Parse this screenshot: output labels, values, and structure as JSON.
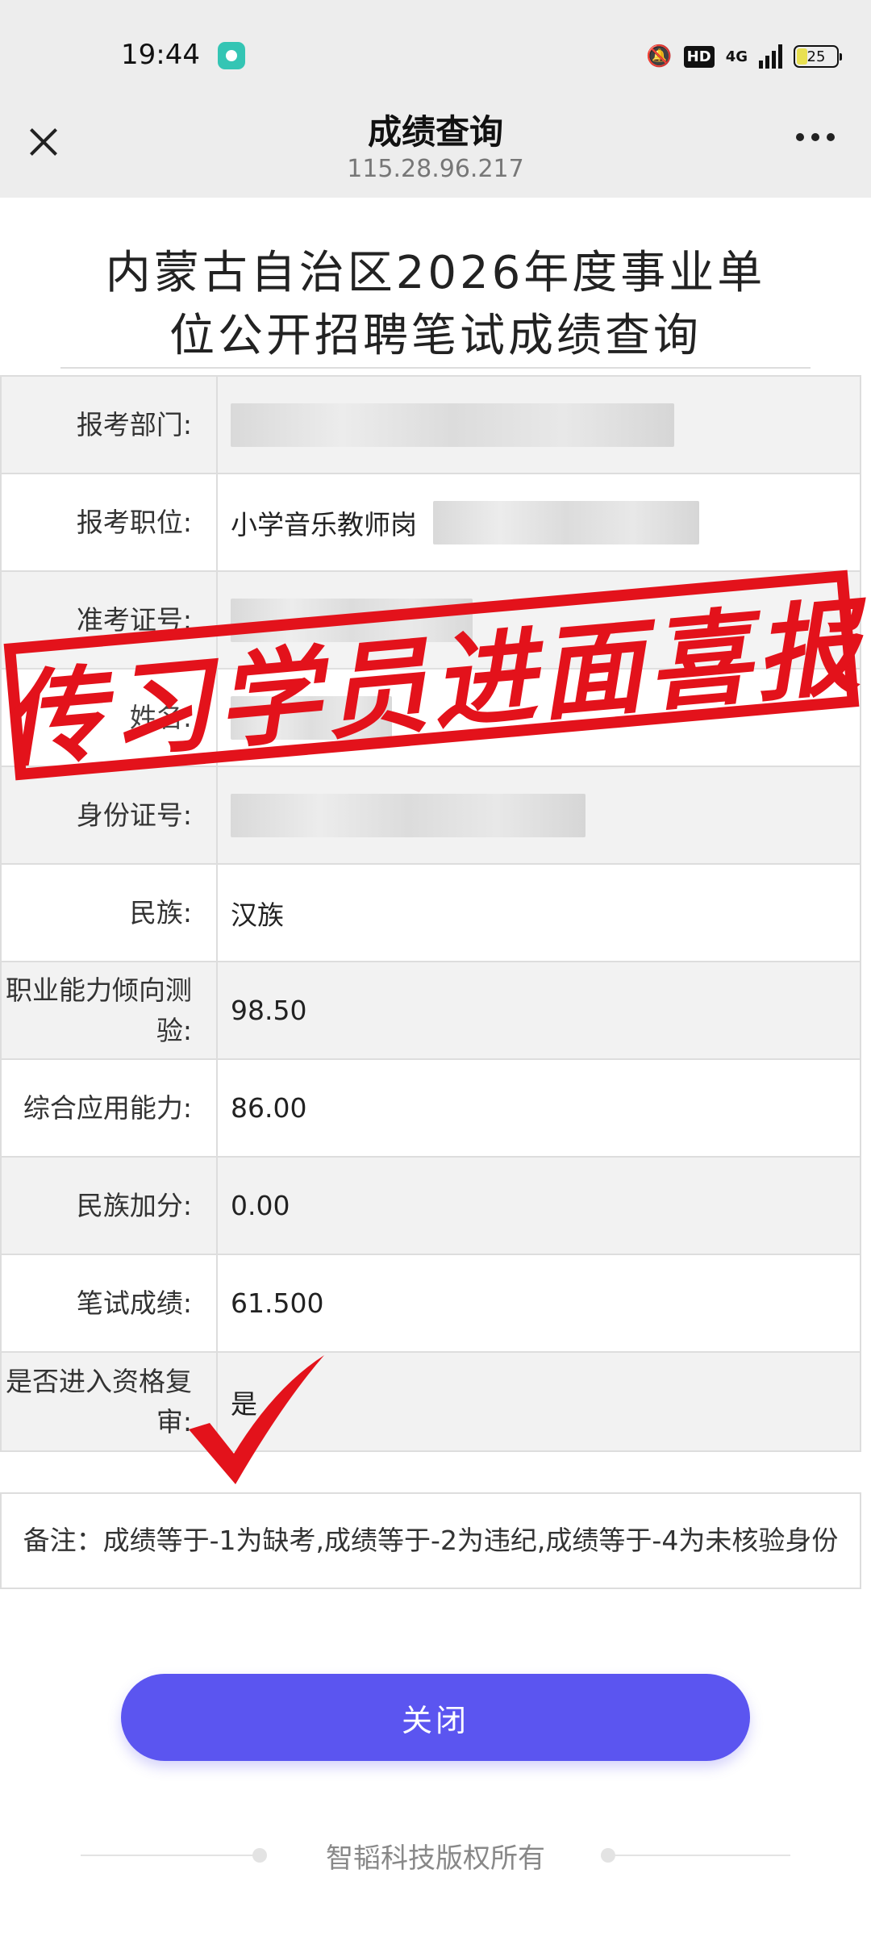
{
  "status_bar": {
    "time": "19:44",
    "hd": "HD",
    "network": "4G",
    "battery": "25"
  },
  "nav": {
    "title": "成绩查询",
    "url": "115.28.96.217"
  },
  "page": {
    "title_line1": "内蒙古自治区2026年度事业单",
    "title_line2": "位公开招聘笔试成绩查询"
  },
  "table": {
    "rows": [
      {
        "label": "报考部门:",
        "value": ""
      },
      {
        "label": "报考职位:",
        "value": "小学音乐教师岗"
      },
      {
        "label": "准考证号:",
        "value": ""
      },
      {
        "label": "姓名:",
        "value": ""
      },
      {
        "label": "身份证号:",
        "value": ""
      },
      {
        "label": "民族:",
        "value": "汉族"
      },
      {
        "label": "职业能力倾向测验:",
        "value": "98.50"
      },
      {
        "label": "综合应用能力:",
        "value": "86.00"
      },
      {
        "label": "民族加分:",
        "value": "0.00"
      },
      {
        "label": "笔试成绩:",
        "value": "61.500"
      },
      {
        "label": "是否进入资格复审:",
        "value": "是"
      }
    ]
  },
  "note": "备注：成绩等于-1为缺考,成绩等于-2为违纪,成绩等于-4为未核验身份",
  "close_button": "关闭",
  "footer": "智韬科技版权所有",
  "overlay": {
    "stamp_text": "传习学员进面喜报",
    "stamp_color": "#e3121b"
  },
  "colors": {
    "accent": "#5b55f0",
    "topbar": "#ededed"
  }
}
